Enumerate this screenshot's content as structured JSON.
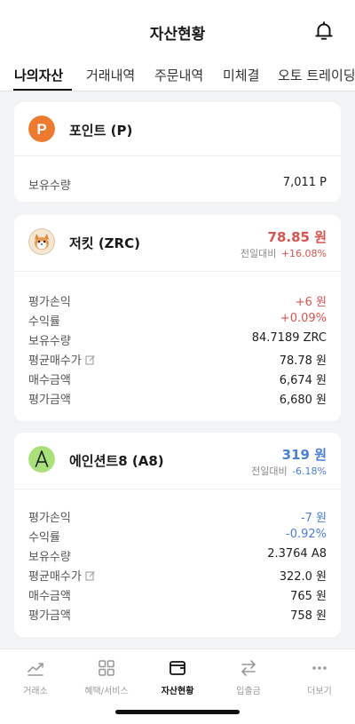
{
  "header": {
    "title": "자산현황",
    "icon": "bell-icon"
  },
  "tabs": [
    {
      "label": "나의자산",
      "active": true
    },
    {
      "label": "거래내역"
    },
    {
      "label": "주문내역"
    },
    {
      "label": "미체결"
    },
    {
      "label": "오토 트레이딩"
    }
  ],
  "point_card": {
    "name": "포인트 (P)",
    "icon": "point-logo-icon",
    "logo_letter": "P",
    "logo_color": "#ee7a2f",
    "holdings_label": "보유수량",
    "holdings_value": "7,011 P"
  },
  "coins": [
    {
      "name": "저킷 (ZRC)",
      "icon": "zrc-logo-icon",
      "price": "78.85 원",
      "price_color": "#d9534f",
      "change_label": "전일대비",
      "change_value": "+16.08%",
      "change_color": "#d9534f",
      "rows": [
        {
          "label": "평가손익",
          "value": "+6 원",
          "color": "red"
        },
        {
          "label": "수익률",
          "value": "+0.09%",
          "color": "red"
        },
        {
          "label": "보유수량",
          "value": "84.7189 ZRC"
        },
        {
          "label": "평균매수가",
          "value": "78.78 원",
          "editable": true
        },
        {
          "label": "매수금액",
          "value": "6,674 원"
        },
        {
          "label": "평가금액",
          "value": "6,680 원"
        }
      ]
    },
    {
      "name": "에인션트8 (A8)",
      "icon": "a8-logo-icon",
      "price": "319 원",
      "price_color": "#4a7fd6",
      "change_label": "전일대비",
      "change_value": "-6.18%",
      "change_color": "#4a7fd6",
      "rows": [
        {
          "label": "평가손익",
          "value": "-7 원",
          "color": "blue"
        },
        {
          "label": "수익률",
          "value": "-0.92%",
          "color": "blue"
        },
        {
          "label": "보유수량",
          "value": "2.3764 A8"
        },
        {
          "label": "평균매수가",
          "value": "322.0 원",
          "editable": true
        },
        {
          "label": "매수금액",
          "value": "765 원"
        },
        {
          "label": "평가금액",
          "value": "758 원"
        }
      ]
    }
  ],
  "bottom_nav": [
    {
      "label": "거래소",
      "icon": "chart-icon"
    },
    {
      "label": "혜택/서비스",
      "icon": "grid-icon"
    },
    {
      "label": "자산현황",
      "icon": "wallet-icon",
      "active": true
    },
    {
      "label": "입출금",
      "icon": "transfer-icon"
    },
    {
      "label": "더보기",
      "icon": "more-icon"
    }
  ]
}
